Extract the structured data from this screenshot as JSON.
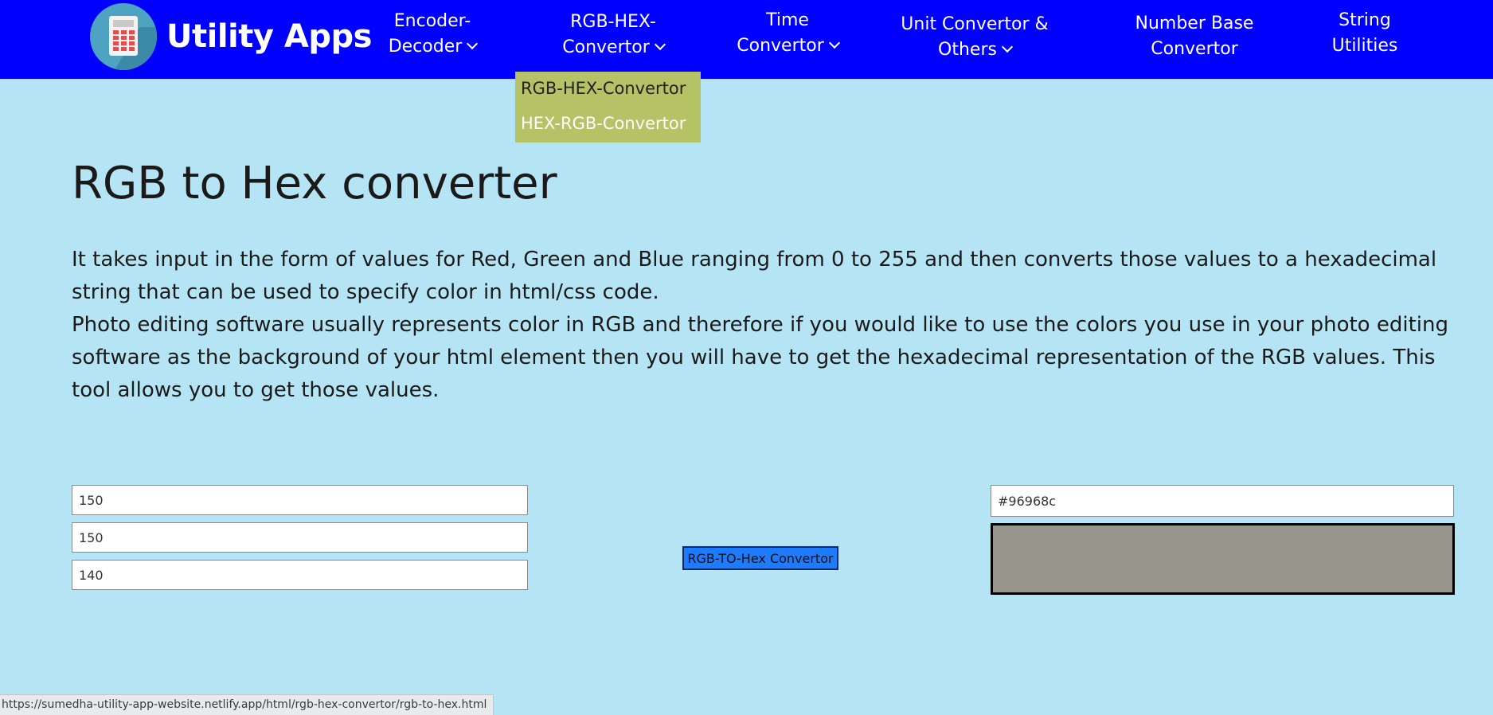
{
  "navbar": {
    "brand": "Utility Apps",
    "background": "#0000ff",
    "items": [
      {
        "line1": "Encoder-",
        "line2": "Decoder",
        "has_dropdown": true
      },
      {
        "line1": "RGB-HEX-",
        "line2": "Convertor",
        "has_dropdown": true
      },
      {
        "line1": "Time",
        "line2": "Convertor",
        "has_dropdown": true
      },
      {
        "line1": "Unit Convertor &",
        "line2": "Others",
        "has_dropdown": true
      },
      {
        "line1": "Number Base",
        "line2": "Convertor",
        "has_dropdown": false
      },
      {
        "line1": "String",
        "line2": "Utilities",
        "has_dropdown": false
      }
    ]
  },
  "dropdown": {
    "items": [
      "RGB-HEX-Convertor",
      "HEX-RGB-Convertor"
    ],
    "background": "#b5c266"
  },
  "page": {
    "title": "RGB to Hex converter",
    "description_1": "It takes input in the form of values for Red, Green and Blue ranging from 0 to 255 and then converts those values to a hexadecimal string that can be used to specify color in html/css code.",
    "description_2": "Photo editing software usually represents color in RGB and therefore if you would like to use the colors you use in your photo editing software as the background of your html element then you will have to get the hexadecimal representation of the RGB values. This tool allows you to get those values.",
    "background": "#b5e5f4"
  },
  "converter": {
    "red": "150",
    "green": "150",
    "blue": "140",
    "button_label": "RGB-TO-Hex Convertor",
    "button_color": "#1e7bff",
    "hex_value": "#96968c",
    "preview_color": "#96968c"
  },
  "status_bar": {
    "url": "https://sumedha-utility-app-website.netlify.app/html/rgb-hex-convertor/rgb-to-hex.html"
  },
  "icons": {
    "logo": "calculator-icon",
    "dropdown_indicator": "chevron-down-icon"
  }
}
